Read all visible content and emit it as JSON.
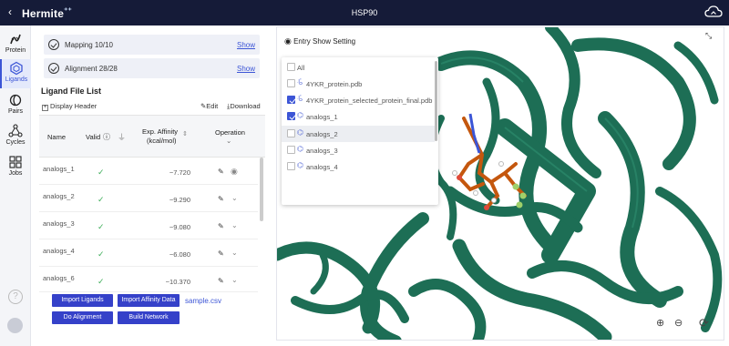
{
  "app": {
    "logo": "Hermite",
    "title": "HSP90"
  },
  "nav": [
    {
      "label": "Protein",
      "icon": "protein-icon"
    },
    {
      "label": "Ligands",
      "icon": "ligands-icon",
      "active": true
    },
    {
      "label": "Pairs",
      "icon": "pairs-icon"
    },
    {
      "label": "Cycles",
      "icon": "cycles-icon"
    },
    {
      "label": "Jobs",
      "icon": "jobs-icon"
    }
  ],
  "status": {
    "mapping": "Mapping  10/10",
    "alignment": "Alignment  28/28",
    "show": "Show"
  },
  "ligand_list": {
    "title": "Ligand File List",
    "display_header": "Display Header",
    "edit": "Edit",
    "download": "Download",
    "columns": {
      "name": "Name",
      "valid": "Valid",
      "affinity_1": "Exp. Affinity",
      "affinity_2": "(kcal/mol)",
      "operation": "Operation"
    },
    "rows": [
      {
        "name": "analogs_1",
        "valid": "✓",
        "affinity": "−7.720"
      },
      {
        "name": "analogs_2",
        "valid": "✓",
        "affinity": "−9.290"
      },
      {
        "name": "analogs_3",
        "valid": "✓",
        "affinity": "−9.080"
      },
      {
        "name": "analogs_4",
        "valid": "✓",
        "affinity": "−6.080"
      },
      {
        "name": "analogs_6",
        "valid": "✓",
        "affinity": "−10.370"
      }
    ]
  },
  "buttons": {
    "import_ligands": "Import Ligands",
    "import_affinity": "Import Affinity Data",
    "sample": "sample.csv",
    "do_alignment": "Do Alignment",
    "build_network": "Build Network"
  },
  "viewer": {
    "entry_setting": "Entry Show Setting",
    "items": [
      {
        "label": "All",
        "checked": false
      },
      {
        "label": "4YKR_protein.pdb",
        "checked": false
      },
      {
        "label": "4YKR_protein_selected_protein_final.pdb",
        "checked": true
      },
      {
        "label": "analogs_1",
        "checked": true
      },
      {
        "label": "analogs_2",
        "checked": false
      },
      {
        "label": "analogs_3",
        "checked": false
      },
      {
        "label": "analogs_4",
        "checked": false
      }
    ]
  },
  "colors": {
    "brand_dark": "#151b38",
    "accent": "#3c55d6",
    "protein": "#1d6e55",
    "ligand": "#c4570e"
  }
}
